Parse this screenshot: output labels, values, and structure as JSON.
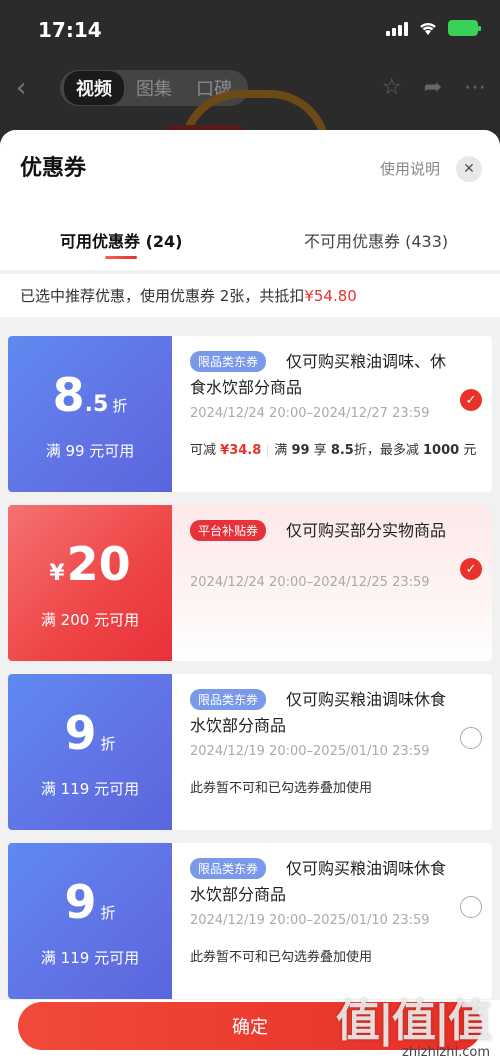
{
  "status_bar": {
    "time": "17:14"
  },
  "background_nav": {
    "tabs": [
      "视频",
      "图集",
      "口碑"
    ],
    "active_tab": "视频"
  },
  "sheet": {
    "title": "优惠券",
    "help_link": "使用说明",
    "close": "✕",
    "tabs": [
      {
        "label": "可用优惠券 (24)",
        "active": true
      },
      {
        "label": "不可用优惠券 (433)",
        "active": false
      }
    ],
    "summary_prefix": "已选中推荐优惠，使用优惠券 2张，共抵扣",
    "summary_amount": "¥54.80"
  },
  "coupons": [
    {
      "style": "blue",
      "value_int": "8",
      "value_dec": ".5",
      "value_unit": "折",
      "condition": "满 99 元可用",
      "badge": "限品类东券",
      "description": "仅可购买粮油调味、休食水饮部分商品",
      "period": "2024/12/24 20:00–2024/12/27 23:59",
      "note_prefix": "可减",
      "note_amount": "¥34.8",
      "note_rule_a": "满",
      "note_rule_b": "99",
      "note_rule_c": "享",
      "note_rule_d": "8.5",
      "note_rule_e": "折，最多减",
      "note_rule_f": "1000",
      "note_rule_g": "元",
      "checked": true
    },
    {
      "style": "red",
      "currency": "¥",
      "value_int": "20",
      "condition": "满 200 元可用",
      "badge": "平台补贴券",
      "description": "仅可购买部分实物商品",
      "period": "2024/12/24 20:00–2024/12/25 23:59",
      "checked": true
    },
    {
      "style": "blue",
      "value_int": "9",
      "value_unit": "折",
      "condition": "满 119 元可用",
      "badge": "限品类东券",
      "description": "仅可购买粮油调味休食水饮部分商品",
      "period": "2024/12/19 20:00–2025/01/10 23:59",
      "note": "此券暂不可和已勾选券叠加使用",
      "checked": false
    },
    {
      "style": "blue",
      "value_int": "9",
      "value_unit": "折",
      "condition": "满 119 元可用",
      "badge": "限品类东券",
      "description": "仅可购买粮油调味休食水饮部分商品",
      "period": "2024/12/19 20:00–2025/01/10 23:59",
      "note": "此券暂不可和已勾选券叠加使用",
      "checked": false
    }
  ],
  "confirm_label": "确定",
  "watermark": {
    "logo": "值|值|值",
    "site": "zhizhizhi.com"
  },
  "colors": {
    "accent": "#e8322a",
    "coupon_blue": "#6172e4",
    "coupon_red": "#ee4445"
  }
}
